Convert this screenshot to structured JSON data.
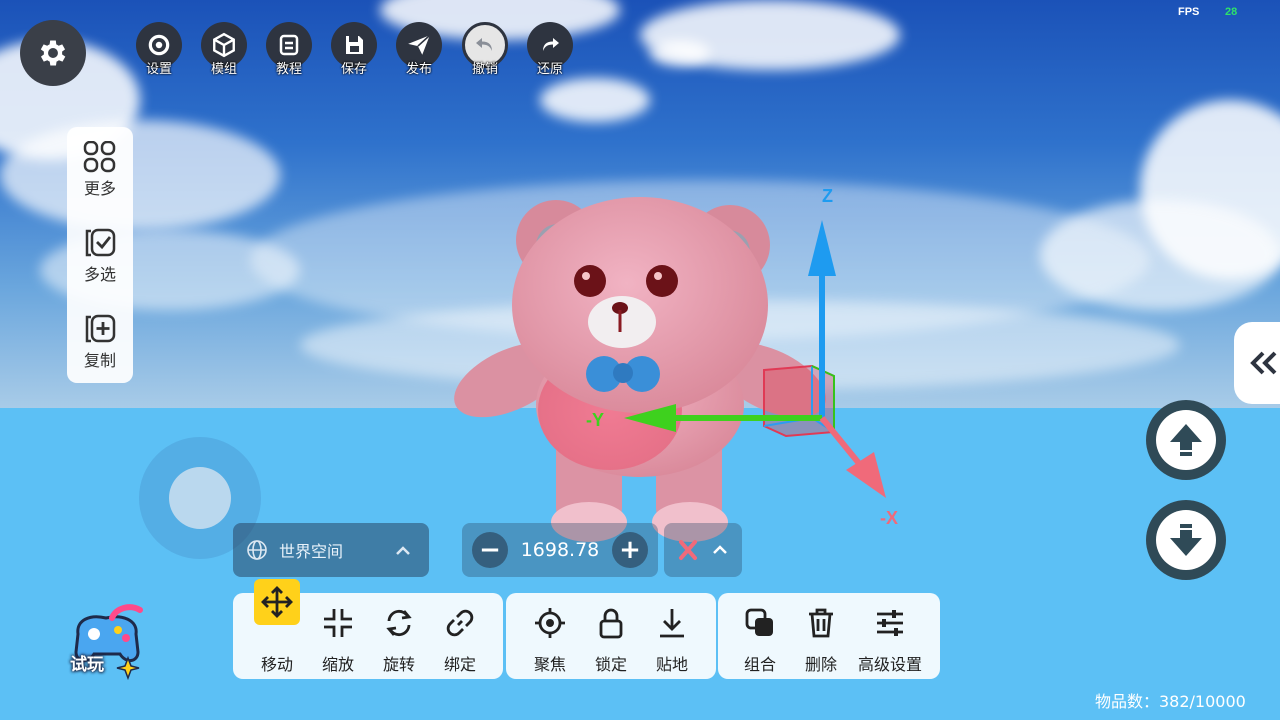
{
  "top_toolbar": {
    "items": [
      {
        "label": "设置",
        "icon": "gear-icon"
      },
      {
        "label": "模组",
        "icon": "cube-icon"
      },
      {
        "label": "教程",
        "icon": "book-icon"
      },
      {
        "label": "保存",
        "icon": "save-icon"
      },
      {
        "label": "发布",
        "icon": "send-icon"
      },
      {
        "label": "撤销",
        "icon": "undo-icon"
      },
      {
        "label": "还原",
        "icon": "redo-icon"
      }
    ]
  },
  "fps": {
    "label": "FPS",
    "value": "28"
  },
  "left_panel": {
    "items": [
      {
        "label": "更多",
        "icon": "grid-icon"
      },
      {
        "label": "多选",
        "icon": "multi-select-icon"
      },
      {
        "label": "复制",
        "icon": "copy-icon"
      }
    ]
  },
  "gizmo": {
    "z_label": "Z",
    "y_label": "-Y",
    "x_label": "-X"
  },
  "space_select": {
    "label": "世界空间"
  },
  "value_box": {
    "value": "1698.78",
    "minus": "−",
    "plus": "+"
  },
  "tool_groups": [
    {
      "tools": [
        {
          "label": "移动",
          "icon": "move-icon",
          "active": true
        },
        {
          "label": "缩放",
          "icon": "scale-icon"
        },
        {
          "label": "旋转",
          "icon": "rotate-icon"
        },
        {
          "label": "绑定",
          "icon": "link-icon"
        }
      ]
    },
    {
      "tools": [
        {
          "label": "聚焦",
          "icon": "focus-icon"
        },
        {
          "label": "锁定",
          "icon": "lock-icon"
        },
        {
          "label": "贴地",
          "icon": "snap-ground-icon"
        }
      ]
    },
    {
      "tools": [
        {
          "label": "组合",
          "icon": "group-icon"
        },
        {
          "label": "删除",
          "icon": "trash-icon"
        },
        {
          "label": "高级设置",
          "icon": "sliders-icon"
        }
      ]
    }
  ],
  "item_count": {
    "text": "物品数：382/10000"
  },
  "play_logo": {
    "text": "试玩"
  },
  "colors": {
    "accent": "#ffd11a",
    "axis_z": "#1e9bf0",
    "axis_y": "#3ed11e",
    "axis_x": "#f06a7a",
    "dark_button": "#2e3440"
  }
}
